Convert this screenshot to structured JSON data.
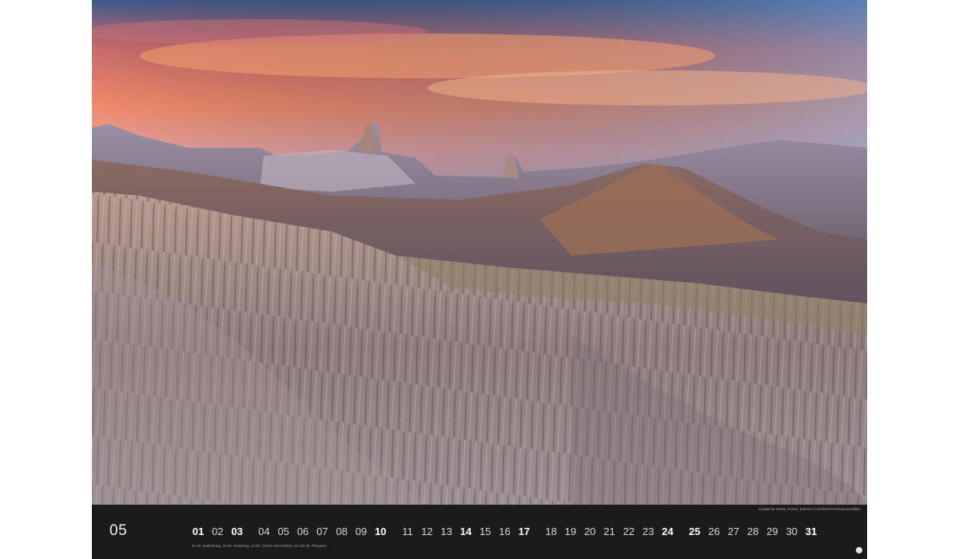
{
  "calendar": {
    "month": "05",
    "photo_credit": "Ciudad de Roma, Potosí, Bolivien © INTERFOTO/Samuel Billon",
    "holidays_note": "01.05. Maifeiertag, 10.05. Muttertag, 14.05. Christi Himmelfahrt, 24./25.05. Pfingsten",
    "days": [
      {
        "label": "01",
        "bold": true
      },
      {
        "label": "02",
        "bold": false
      },
      {
        "label": "03",
        "bold": true
      },
      {
        "label": "04",
        "bold": false
      },
      {
        "label": "05",
        "bold": false
      },
      {
        "label": "06",
        "bold": false
      },
      {
        "label": "07",
        "bold": false
      },
      {
        "label": "08",
        "bold": false
      },
      {
        "label": "09",
        "bold": false
      },
      {
        "label": "10",
        "bold": true
      },
      {
        "label": "11",
        "bold": false
      },
      {
        "label": "12",
        "bold": false
      },
      {
        "label": "13",
        "bold": false
      },
      {
        "label": "14",
        "bold": true
      },
      {
        "label": "15",
        "bold": false
      },
      {
        "label": "16",
        "bold": false
      },
      {
        "label": "17",
        "bold": true
      },
      {
        "label": "18",
        "bold": false
      },
      {
        "label": "19",
        "bold": false
      },
      {
        "label": "20",
        "bold": false
      },
      {
        "label": "21",
        "bold": false
      },
      {
        "label": "22",
        "bold": false
      },
      {
        "label": "23",
        "bold": false
      },
      {
        "label": "24",
        "bold": true
      },
      {
        "label": "25",
        "bold": true
      },
      {
        "label": "26",
        "bold": false
      },
      {
        "label": "27",
        "bold": false
      },
      {
        "label": "28",
        "bold": false
      },
      {
        "label": "29",
        "bold": false
      },
      {
        "label": "30",
        "bold": false
      },
      {
        "label": "31",
        "bold": true
      }
    ]
  }
}
